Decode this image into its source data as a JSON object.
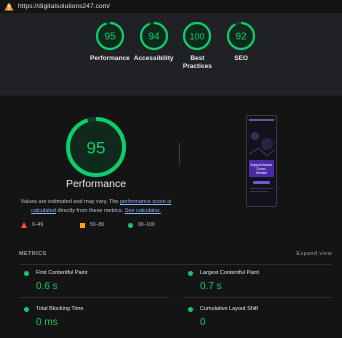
{
  "browser": {
    "url": "https://digitalsolutions247.com/"
  },
  "summary": [
    {
      "score": "95",
      "label": "Performance",
      "value": 95
    },
    {
      "score": "94",
      "label": "Accessibility",
      "value": 94
    },
    {
      "score": "100",
      "label": "Best\nPractices",
      "value": 100
    },
    {
      "score": "92",
      "label": "SEO",
      "value": 92
    }
  ],
  "performance": {
    "score": "95",
    "value": 95,
    "title": "Performance",
    "note_start": "Values are estimated and may vary. The ",
    "note_link1": "performance score is calculated",
    "note_mid": " directly from these metrics. ",
    "note_link2": "See calculator."
  },
  "legend": {
    "fail": "0–49",
    "average": "50–89",
    "pass": "90–100"
  },
  "metrics": {
    "heading": "METRICS",
    "expand": "Expand view",
    "items": [
      {
        "name": "First Contentful Paint",
        "value": "0.6 s"
      },
      {
        "name": "Largest Contentful Paint",
        "value": "0.7 s"
      },
      {
        "name": "Total Blocking Time",
        "value": "0 ms"
      },
      {
        "name": "Cumulative Layout Shift",
        "value": "0"
      }
    ]
  },
  "colors": {
    "pass": "#0cce6b",
    "average": "#ffa400",
    "fail": "#ff4e42",
    "link": "#8ab4f8"
  },
  "screenshot_text": "Support Award Como Service"
}
